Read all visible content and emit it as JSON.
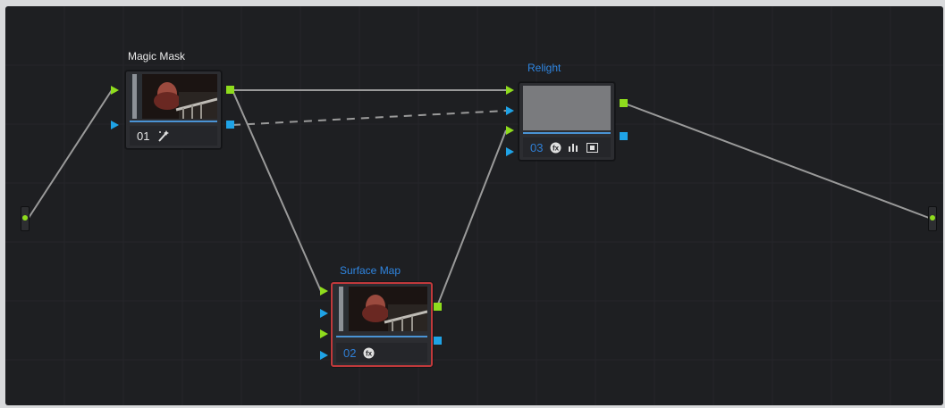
{
  "nodes": {
    "magic_mask": {
      "title": "Magic Mask",
      "number": "01",
      "icons": [
        "magic-mask-icon"
      ]
    },
    "relight": {
      "title": "Relight",
      "number": "03",
      "icons": [
        "fx-icon",
        "histogram-icon",
        "lut-icon"
      ]
    },
    "surface_map": {
      "title": "Surface Map",
      "number": "02",
      "icons": [
        "fx-icon"
      ]
    }
  },
  "colors": {
    "canvas": "#1e1f22",
    "rgb_port": "#8fdc1d",
    "key_port": "#1fa3e6",
    "selected_border": "#c0393b",
    "title_blue": "#2f85e0",
    "wire": "#9a9a9a"
  }
}
